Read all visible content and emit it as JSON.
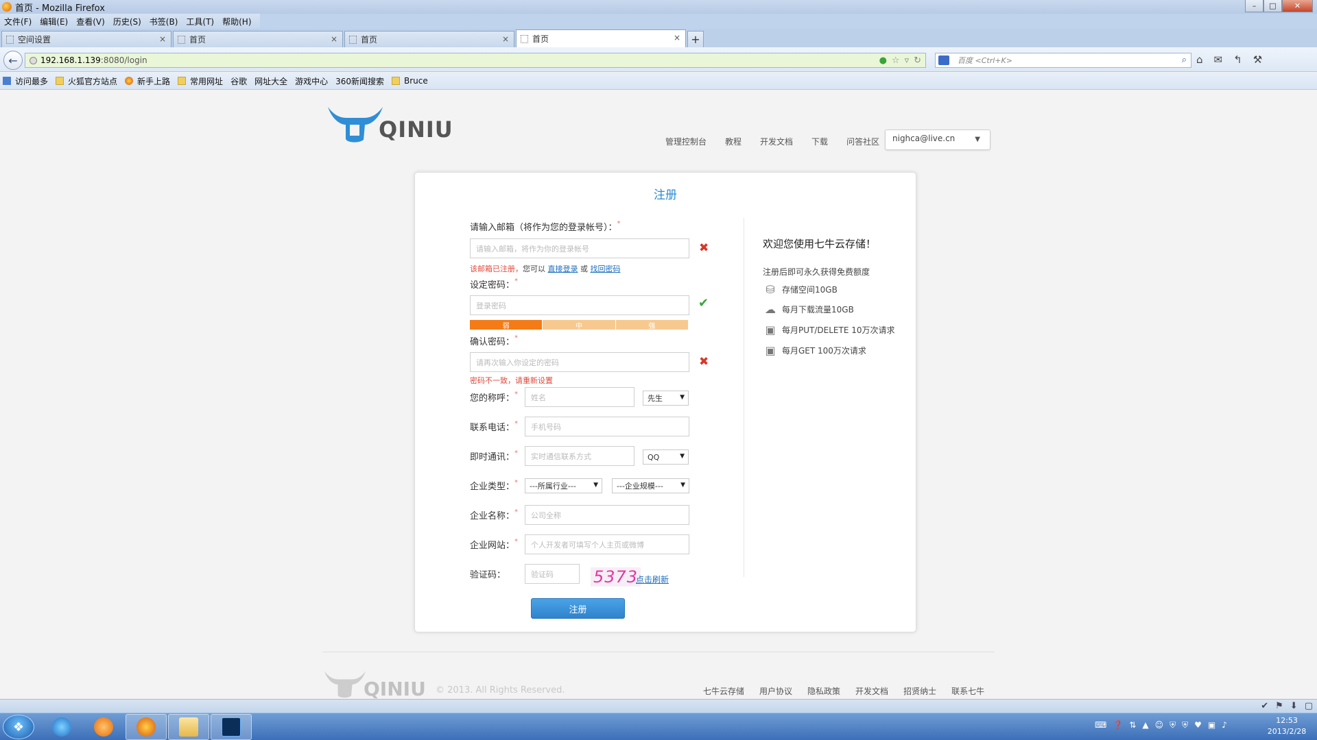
{
  "window": {
    "title": "首页 - Mozilla Firefox",
    "min": "–",
    "max": "□",
    "close": "✕"
  },
  "menu": [
    "文件(F)",
    "编辑(E)",
    "查看(V)",
    "历史(S)",
    "书签(B)",
    "工具(T)",
    "帮助(H)"
  ],
  "tabs": [
    {
      "label": "空间设置",
      "close": "×"
    },
    {
      "label": "首页",
      "close": "×"
    },
    {
      "label": "首页",
      "close": "×"
    },
    {
      "label": "首页",
      "close": "×"
    }
  ],
  "newtab": "+",
  "nav": {
    "url_host": "192.168.1.139",
    "url_path": ":8080/login",
    "search_placeholder": "百度 <Ctrl+K>"
  },
  "bookmarks": [
    {
      "label": "访问最多",
      "icon": "blue"
    },
    {
      "label": "火狐官方站点",
      "icon": "folder"
    },
    {
      "label": "新手上路",
      "icon": "ffx"
    },
    {
      "label": "常用网址",
      "icon": "folder"
    },
    {
      "label": "谷歌",
      "icon": "page"
    },
    {
      "label": "网址大全",
      "icon": "page"
    },
    {
      "label": "游戏中心",
      "icon": "page"
    },
    {
      "label": "360新闻搜索",
      "icon": "page"
    },
    {
      "label": "Bruce",
      "icon": "folder"
    }
  ],
  "header": {
    "logo_text": "QINIU",
    "nav": [
      "管理控制台",
      "教程",
      "开发文档",
      "下载",
      "问答社区"
    ],
    "user": "nighca@live.cn"
  },
  "form": {
    "title": "注册",
    "email_label": "请输入邮箱（将作为您的登录帐号）：",
    "email_placeholder": "请输入邮箱，将作为你的登录帐号",
    "email_error": "该邮箱已注册，",
    "email_error_mid": "您可以",
    "email_login_link": "直接登录",
    "email_or": "或",
    "email_recover_link": "找回密码",
    "password_label": "设定密码：",
    "password_placeholder": "登录密码",
    "strength": [
      "弱",
      "中",
      "强"
    ],
    "strength_colors": [
      "#f47b16",
      "#f8c98f",
      "#f8c98f"
    ],
    "confirm_label": "确认密码：",
    "confirm_placeholder": "请再次输入你设定的密码",
    "confirm_error": "密码不一致，请重新设置",
    "name_label": "您的称呼：",
    "name_placeholder": "姓名",
    "title_select": "先生",
    "phone_label": "联系电话：",
    "phone_placeholder": "手机号码",
    "im_label": "即时通讯：",
    "im_placeholder": "实时通信联系方式",
    "im_select": "QQ",
    "company_type_label": "企业类型：",
    "industry_select": "---所属行业---",
    "scale_select": "---企业规模---",
    "company_name_label": "企业名称：",
    "company_name_placeholder": "公司全称",
    "website_label": "企业网站：",
    "website_placeholder": "个人开发者可填写个人主页或微博",
    "captcha_label": "验证码：",
    "captcha_placeholder": "验证码",
    "captcha_code": "5373",
    "captcha_refresh": "点击刷新",
    "submit": "注册",
    "required_mark": "*"
  },
  "sidebar": {
    "title": "欢迎您使用七牛云存储！",
    "subtitle": "注册后即可永久获得免费额度",
    "benefits": [
      "存储空间10GB",
      "每月下载流量10GB",
      "每月PUT/DELETE 10万次请求",
      "每月GET 100万次请求"
    ]
  },
  "footer": {
    "copyright": "© 2013. All Rights Reserved.",
    "links": [
      "七牛云存储",
      "用户协议",
      "隐私政策",
      "开发文档",
      "招贤纳士",
      "联系七牛"
    ]
  },
  "taskbar": {
    "time": "12:53",
    "date": "2013/2/28"
  },
  "colors": {
    "accent": "#2b8bd0",
    "error": "#d9362a",
    "ok": "#3aa53a"
  }
}
